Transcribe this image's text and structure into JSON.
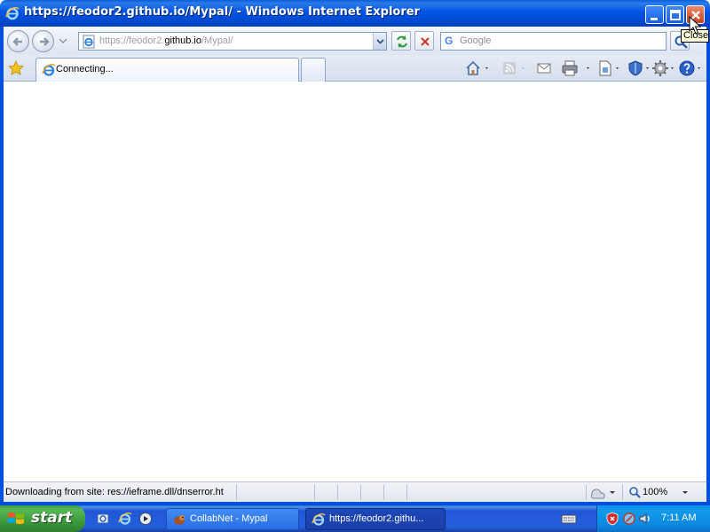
{
  "window": {
    "title": "https://feodor2.github.io/Mypal/ - Windows Internet Explorer",
    "close_tooltip": "Close"
  },
  "address_bar": {
    "url_prefix": "https://feodor2.",
    "url_host": "github.io",
    "url_path": "/Mypal/"
  },
  "search_box": {
    "placeholder": "Google"
  },
  "tabs": [
    {
      "label": "Connecting..."
    }
  ],
  "status_bar": {
    "text": "Downloading from site: res://ieframe.dll/dnserror.ht",
    "zoom": "100%"
  },
  "taskbar": {
    "start_label": "start",
    "buttons": [
      {
        "label": "CollabNet - Mypal"
      },
      {
        "label": "https://feodor2.githu..."
      }
    ],
    "clock": "7:11 AM"
  },
  "icons": {
    "title": "ie-icon",
    "back": "back-arrow-icon",
    "forward": "forward-arrow-icon",
    "favorites": "star-icon",
    "home": "home-icon",
    "feeds": "rss-icon",
    "mail": "mail-icon",
    "print": "print-icon",
    "page": "page-icon",
    "safety": "shield-icon",
    "tools": "gear-icon",
    "help": "help-icon"
  },
  "colors": {
    "titlebar": "#0054e3",
    "start": "#3d9a3d",
    "taskbar": "#245edb",
    "tray": "#0c86e0",
    "close_button": "#c7401f"
  }
}
